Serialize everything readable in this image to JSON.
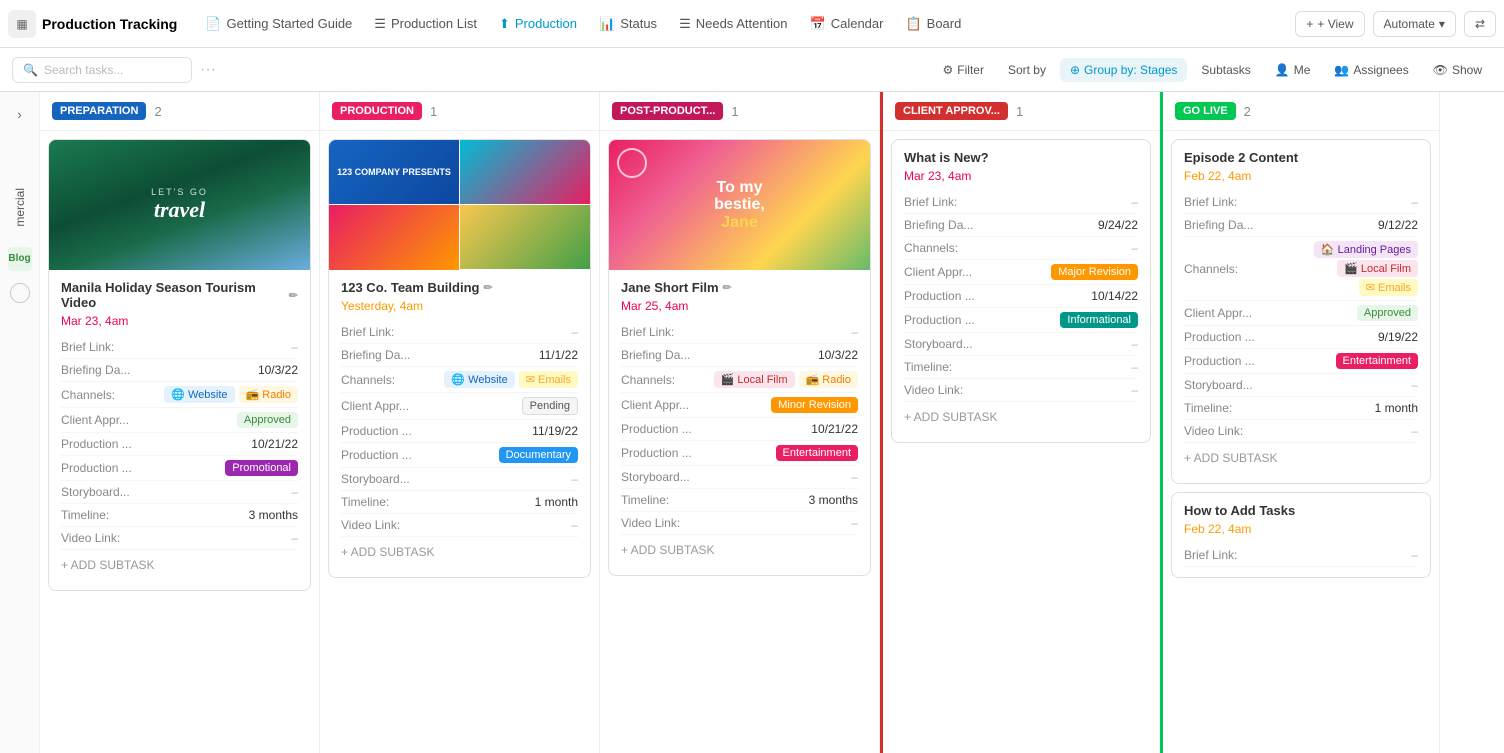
{
  "app": {
    "icon": "▦",
    "title": "Production Tracking"
  },
  "nav": {
    "tabs": [
      {
        "id": "getting-started",
        "label": "Getting Started Guide",
        "icon": "📄",
        "active": false
      },
      {
        "id": "production-list",
        "label": "Production List",
        "icon": "☰",
        "active": false
      },
      {
        "id": "production",
        "label": "Production",
        "icon": "⬆",
        "active": true
      },
      {
        "id": "status",
        "label": "Status",
        "icon": "📊",
        "active": false
      },
      {
        "id": "needs-attention",
        "label": "Needs Attention",
        "icon": "☰",
        "active": false
      },
      {
        "id": "calendar",
        "label": "Calendar",
        "icon": "📅",
        "active": false
      },
      {
        "id": "board",
        "label": "Board",
        "icon": "📋",
        "active": false
      }
    ],
    "view_btn": "+ View",
    "automate_btn": "Automate",
    "share_icon": "⇄"
  },
  "toolbar": {
    "search_placeholder": "Search tasks...",
    "filter_btn": "Filter",
    "sort_btn": "Sort by",
    "group_btn": "Group by: Stages",
    "subtasks_btn": "Subtasks",
    "me_btn": "Me",
    "assignees_btn": "Assignees",
    "show_btn": "Show"
  },
  "lanes": [
    {
      "id": "preparation",
      "label": "PREPARATION",
      "color": "#1565c0",
      "count": "2",
      "cards": [
        {
          "id": "manila",
          "image_type": "solid",
          "image_color": "#1a6b4a",
          "image_text": "Let's go travel",
          "title": "Manila Holiday Season Tourism Video",
          "has_edit": true,
          "date": "Mar 23, 4am",
          "date_color": "red",
          "fields": [
            {
              "label": "Brief Link:",
              "value": "–",
              "type": "text"
            },
            {
              "label": "Briefing Da...",
              "value": "10/3/22",
              "type": "text"
            },
            {
              "label": "Channels:",
              "value": "",
              "type": "tags",
              "tags": [
                {
                  "label": "Website",
                  "style": "website"
                },
                {
                  "label": "Radio",
                  "style": "radio"
                }
              ]
            },
            {
              "label": "Client Appr...",
              "value": "",
              "type": "tags",
              "tags": [
                {
                  "label": "Approved",
                  "style": "green"
                }
              ]
            },
            {
              "label": "Production ...",
              "value": "10/21/22",
              "type": "text"
            },
            {
              "label": "Production ...",
              "value": "",
              "type": "tags",
              "tags": [
                {
                  "label": "Promotional",
                  "style": "purple"
                }
              ]
            },
            {
              "label": "Storyboard...",
              "value": "–",
              "type": "text"
            },
            {
              "label": "Timeline:",
              "value": "3 months",
              "type": "text"
            },
            {
              "label": "Video Link:",
              "value": "–",
              "type": "text"
            }
          ],
          "add_subtask": "+ ADD SUBTASK"
        }
      ]
    },
    {
      "id": "production",
      "label": "PRODUCTION",
      "color": "#e91e63",
      "count": "1",
      "cards": [
        {
          "id": "team-building",
          "image_type": "grid",
          "title": "123 Co. Team Building",
          "has_edit": true,
          "date": "Yesterday, 4am",
          "date_color": "orange",
          "fields": [
            {
              "label": "Brief Link:",
              "value": "–",
              "type": "text"
            },
            {
              "label": "Briefing Da...",
              "value": "11/1/22",
              "type": "text"
            },
            {
              "label": "Channels:",
              "value": "",
              "type": "tags",
              "tags": [
                {
                  "label": "Website",
                  "style": "website"
                },
                {
                  "label": "Emails",
                  "style": "email"
                }
              ]
            },
            {
              "label": "Client Appr...",
              "value": "",
              "type": "tags",
              "tags": [
                {
                  "label": "Pending",
                  "style": "gray"
                }
              ]
            },
            {
              "label": "Production ...",
              "value": "11/19/22",
              "type": "text"
            },
            {
              "label": "Production ...",
              "value": "",
              "type": "tags",
              "tags": [
                {
                  "label": "Documentary",
                  "style": "blue"
                }
              ]
            },
            {
              "label": "Storyboard...",
              "value": "–",
              "type": "text"
            },
            {
              "label": "Timeline:",
              "value": "1 month",
              "type": "text"
            },
            {
              "label": "Video Link:",
              "value": "–",
              "type": "text"
            }
          ],
          "add_subtask": "+ ADD SUBTASK"
        }
      ]
    },
    {
      "id": "post-production",
      "label": "POST-PRODUCT...",
      "color": "#c2185b",
      "count": "1",
      "cards": [
        {
          "id": "jane-short-film",
          "image_type": "pink-promo",
          "title": "Jane Short Film",
          "has_edit": true,
          "date": "Mar 25, 4am",
          "date_color": "red",
          "fields": [
            {
              "label": "Brief Link:",
              "value": "–",
              "type": "text"
            },
            {
              "label": "Briefing Da...",
              "value": "10/3/22",
              "type": "text"
            },
            {
              "label": "Channels:",
              "value": "",
              "type": "tags",
              "tags": [
                {
                  "label": "Local Film",
                  "style": "film"
                },
                {
                  "label": "Radio",
                  "style": "radio"
                }
              ]
            },
            {
              "label": "Client Appr...",
              "value": "",
              "type": "tags",
              "tags": [
                {
                  "label": "Minor Revision",
                  "style": "orange"
                }
              ]
            },
            {
              "label": "Production ...",
              "value": "10/21/22",
              "type": "text"
            },
            {
              "label": "Production ...",
              "value": "",
              "type": "tags",
              "tags": [
                {
                  "label": "Entertainment",
                  "style": "pink"
                }
              ]
            },
            {
              "label": "Storyboard...",
              "value": "–",
              "type": "text"
            },
            {
              "label": "Timeline:",
              "value": "3 months",
              "type": "text"
            },
            {
              "label": "Video Link:",
              "value": "–",
              "type": "text"
            }
          ],
          "add_subtask": "+ ADD SUBTASK"
        }
      ]
    },
    {
      "id": "client-approval",
      "label": "CLIENT APPROV...",
      "color": "#d32f2f",
      "count": "1",
      "cards": [
        {
          "id": "what-is-new",
          "image_type": "none",
          "title": "What is New?",
          "has_edit": false,
          "date": "Mar 23, 4am",
          "date_color": "red",
          "fields": [
            {
              "label": "Brief Link:",
              "value": "–",
              "type": "text"
            },
            {
              "label": "Briefing Da...",
              "value": "9/24/22",
              "type": "text"
            },
            {
              "label": "Channels:",
              "value": "–",
              "type": "text"
            },
            {
              "label": "Client Appr...",
              "value": "",
              "type": "tags",
              "tags": [
                {
                  "label": "Major Revision",
                  "style": "orange"
                }
              ]
            },
            {
              "label": "Production ...",
              "value": "10/14/22",
              "type": "text"
            },
            {
              "label": "Production ...",
              "value": "",
              "type": "tags",
              "tags": [
                {
                  "label": "Informational",
                  "style": "teal"
                }
              ]
            },
            {
              "label": "Storyboard...",
              "value": "–",
              "type": "text"
            },
            {
              "label": "Timeline:",
              "value": "–",
              "type": "text"
            },
            {
              "label": "Video Link:",
              "value": "–",
              "type": "text"
            }
          ],
          "add_subtask": "+ ADD SUBTASK"
        }
      ]
    },
    {
      "id": "go-live",
      "label": "GO LIVE",
      "color": "#00c853",
      "count": "2",
      "cards": [
        {
          "id": "episode-2",
          "image_type": "none",
          "title": "Episode 2 Content",
          "has_edit": false,
          "date": "Feb 22, 4am",
          "date_color": "orange",
          "fields": [
            {
              "label": "Brief Link:",
              "value": "–",
              "type": "text"
            },
            {
              "label": "Briefing Da...",
              "value": "9/12/22",
              "type": "text"
            },
            {
              "label": "Channels:",
              "value": "",
              "type": "tags",
              "tags": [
                {
                  "label": "Landing Pages",
                  "style": "lp"
                },
                {
                  "label": "Local Film",
                  "style": "film"
                },
                {
                  "label": "Emails",
                  "style": "email"
                }
              ]
            },
            {
              "label": "Client Appr...",
              "value": "",
              "type": "tags",
              "tags": [
                {
                  "label": "Approved",
                  "style": "green"
                }
              ]
            },
            {
              "label": "Production ...",
              "value": "9/19/22",
              "type": "text"
            },
            {
              "label": "Production ...",
              "value": "",
              "type": "tags",
              "tags": [
                {
                  "label": "Entertainment",
                  "style": "pink"
                }
              ]
            },
            {
              "label": "Storyboard...",
              "value": "–",
              "type": "text"
            },
            {
              "label": "Timeline:",
              "value": "1 month",
              "type": "text"
            },
            {
              "label": "Video Link:",
              "value": "–",
              "type": "text"
            }
          ],
          "add_subtask": "+ ADD SUBTASK"
        },
        {
          "id": "how-to-add",
          "image_type": "none",
          "title": "How to Add Tasks",
          "has_edit": false,
          "date": "Feb 22, 4am",
          "date_color": "orange",
          "fields": [
            {
              "label": "Brief Link:",
              "value": "–",
              "type": "text"
            }
          ],
          "add_subtask": ""
        }
      ]
    }
  ],
  "sidebar": {
    "collapsed_items": [
      "mercial",
      "Blog"
    ]
  }
}
